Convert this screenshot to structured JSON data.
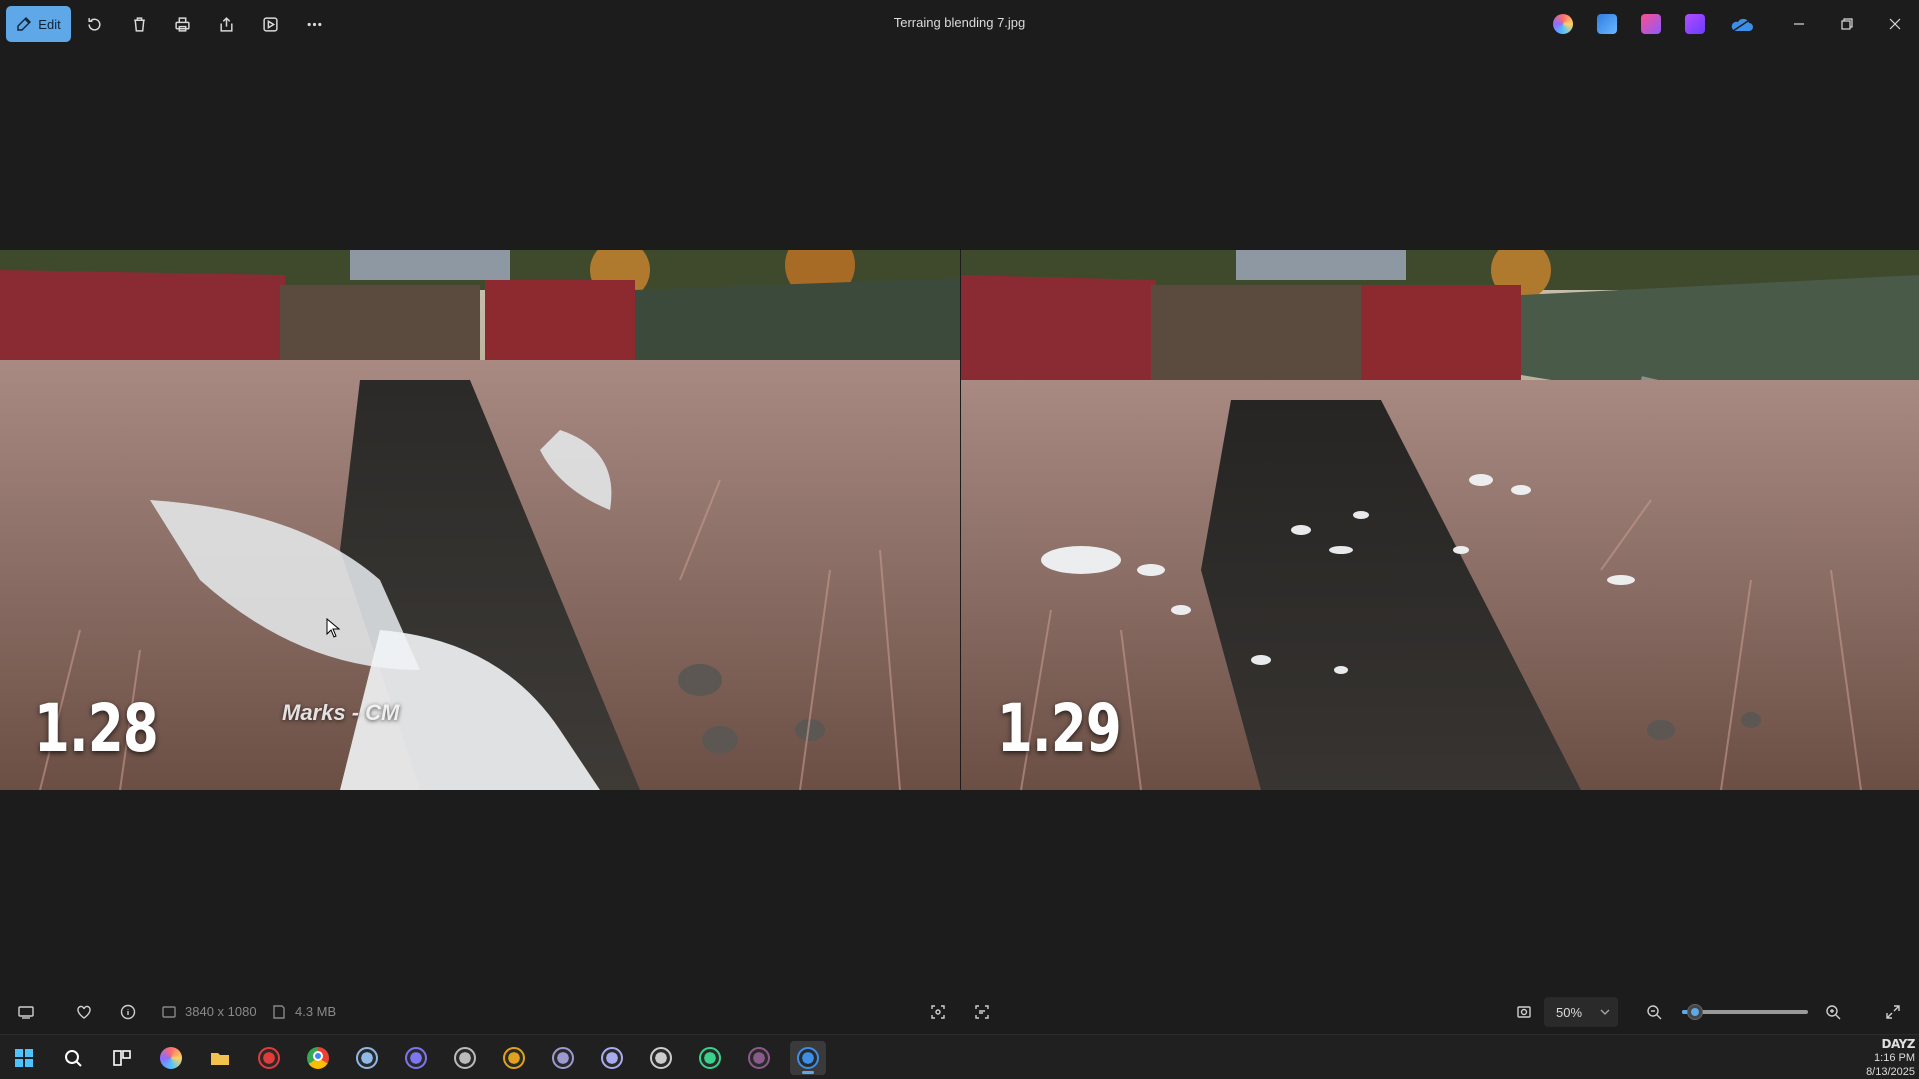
{
  "window": {
    "title": "Terraing blending 7.jpg"
  },
  "toolbar": {
    "edit_label": "Edit",
    "buttons": [
      {
        "name": "rotate-button",
        "icon": "rotate-icon"
      },
      {
        "name": "delete-button",
        "icon": "trash-icon"
      },
      {
        "name": "print-button",
        "icon": "printer-icon"
      },
      {
        "name": "share-button",
        "icon": "share-icon"
      },
      {
        "name": "slideshow-button",
        "icon": "slideshow-icon"
      },
      {
        "name": "more-button",
        "icon": "more-icon"
      }
    ],
    "app_icons": [
      "copilot-icon",
      "designer-icon",
      "clipchamp-icon",
      "video-editor-icon",
      "onedrive-icon"
    ]
  },
  "image": {
    "left_label": "1.28",
    "right_label": "1.29",
    "watermark": "Marks - CM"
  },
  "statusbar": {
    "dimensions": "3840 x 1080",
    "file_size": "4.3 MB",
    "zoom_value": "50%",
    "zoom_slider_fraction": 0.1
  },
  "taskbar": {
    "apps": [
      {
        "name": "start",
        "icon": "windows-icon",
        "color": "#4cc2ff"
      },
      {
        "name": "search",
        "icon": "search-icon",
        "color": "#ffffff"
      },
      {
        "name": "task-view",
        "icon": "task-view-icon",
        "color": "#ffffff"
      },
      {
        "name": "copilot",
        "icon": "copilot-icon",
        "color": "#7a6cff"
      },
      {
        "name": "file-explorer",
        "icon": "folder-icon",
        "color": "#f2c14e"
      },
      {
        "name": "app-red",
        "icon": "camera-icon",
        "color": "#e23b3b"
      },
      {
        "name": "chrome",
        "icon": "chrome-icon",
        "color": "#f3b33d"
      },
      {
        "name": "steam",
        "icon": "steam-icon",
        "color": "#8fb9e8"
      },
      {
        "name": "discord",
        "icon": "discord-icon",
        "color": "#7e76f0"
      },
      {
        "name": "app-circle",
        "icon": "circle-app-icon",
        "color": "#bbbbbb"
      },
      {
        "name": "slack",
        "icon": "slack-icon",
        "color": "#e0a21c"
      },
      {
        "name": "app-grid",
        "icon": "grid-app-icon",
        "color": "#9b9bd1"
      },
      {
        "name": "app-play",
        "icon": "play-app-icon",
        "color": "#aaaaee"
      },
      {
        "name": "app-arrow",
        "icon": "arrow-app-icon",
        "color": "#cccccc"
      },
      {
        "name": "app-green",
        "icon": "green-app-icon",
        "color": "#39d18b"
      },
      {
        "name": "app-game",
        "icon": "game-app-icon",
        "color": "#8a5a8a"
      },
      {
        "name": "photos",
        "icon": "photos-icon",
        "color": "#3d8ee6"
      }
    ],
    "tray_logo": "DAYZ",
    "time": "1:16 PM",
    "date": "8/13/2025"
  },
  "colors": {
    "accent": "#5fa8e8",
    "background": "#1c1c1c",
    "taskbar": "#202020"
  }
}
